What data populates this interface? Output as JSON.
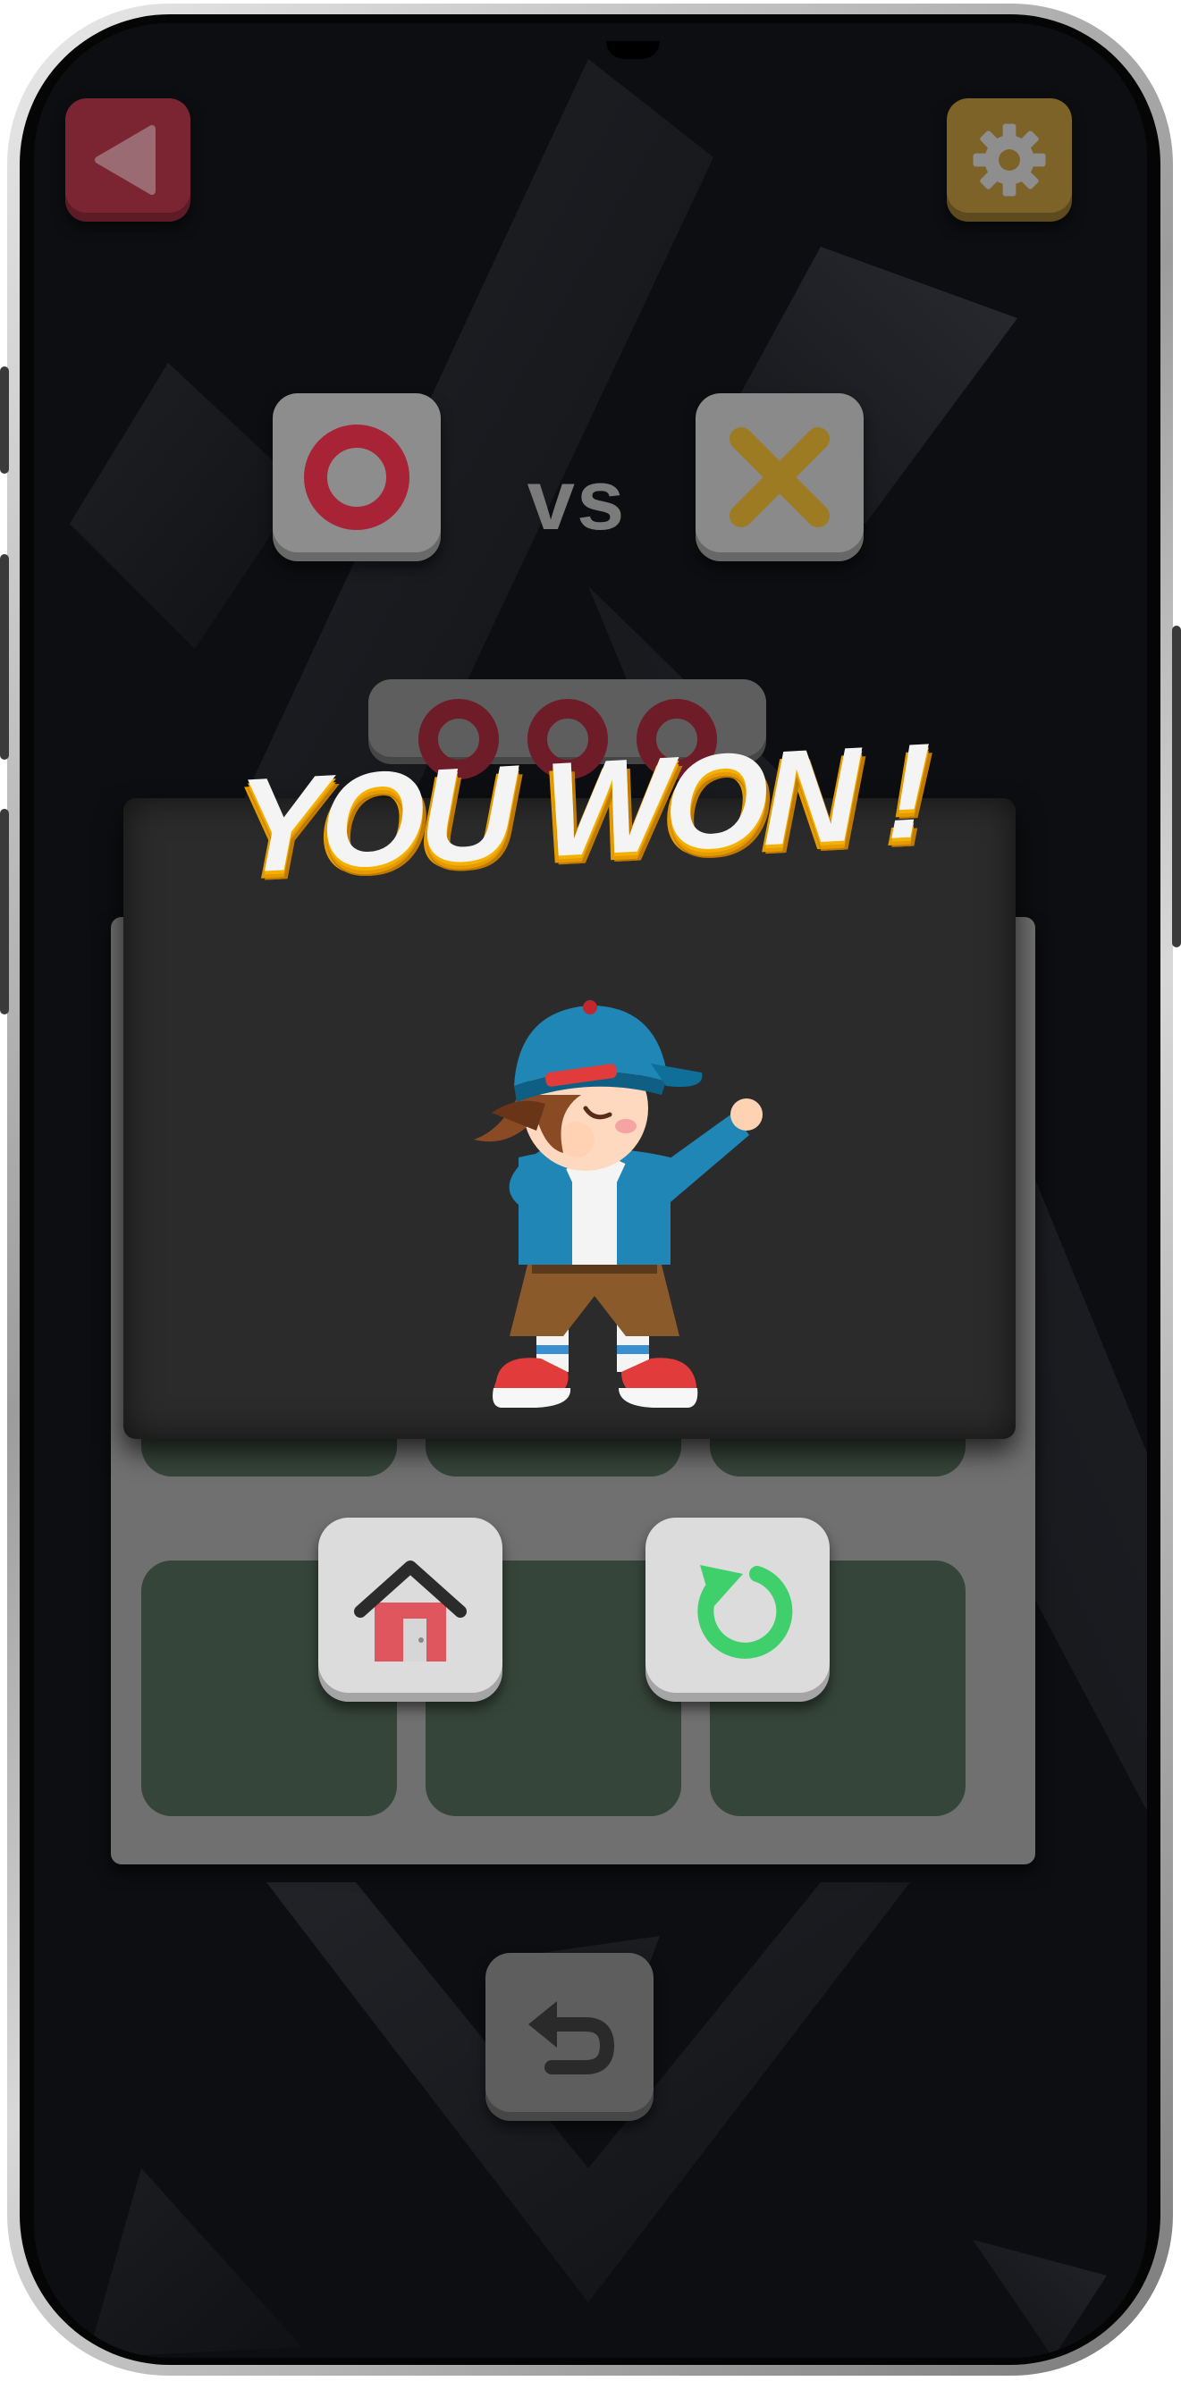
{
  "header": {
    "back_icon": "back-triangle-icon",
    "settings_icon": "gear-icon"
  },
  "players": {
    "player_one_symbol": "O",
    "versus_label": "vs",
    "player_two_symbol": "X",
    "turn_indicator_marks": 3
  },
  "result": {
    "title": "YOU WON !",
    "illustration": "dabbing-boy"
  },
  "actions": {
    "home_icon": "home-icon",
    "restart_icon": "restart-icon",
    "undo_icon": "undo-icon"
  },
  "colors": {
    "o_red": "#c32b41",
    "x_gold": "#c79a1f",
    "board_cell": "#36453a",
    "restart_green": "#3fcf6b",
    "title_gold": "#f5b100"
  }
}
